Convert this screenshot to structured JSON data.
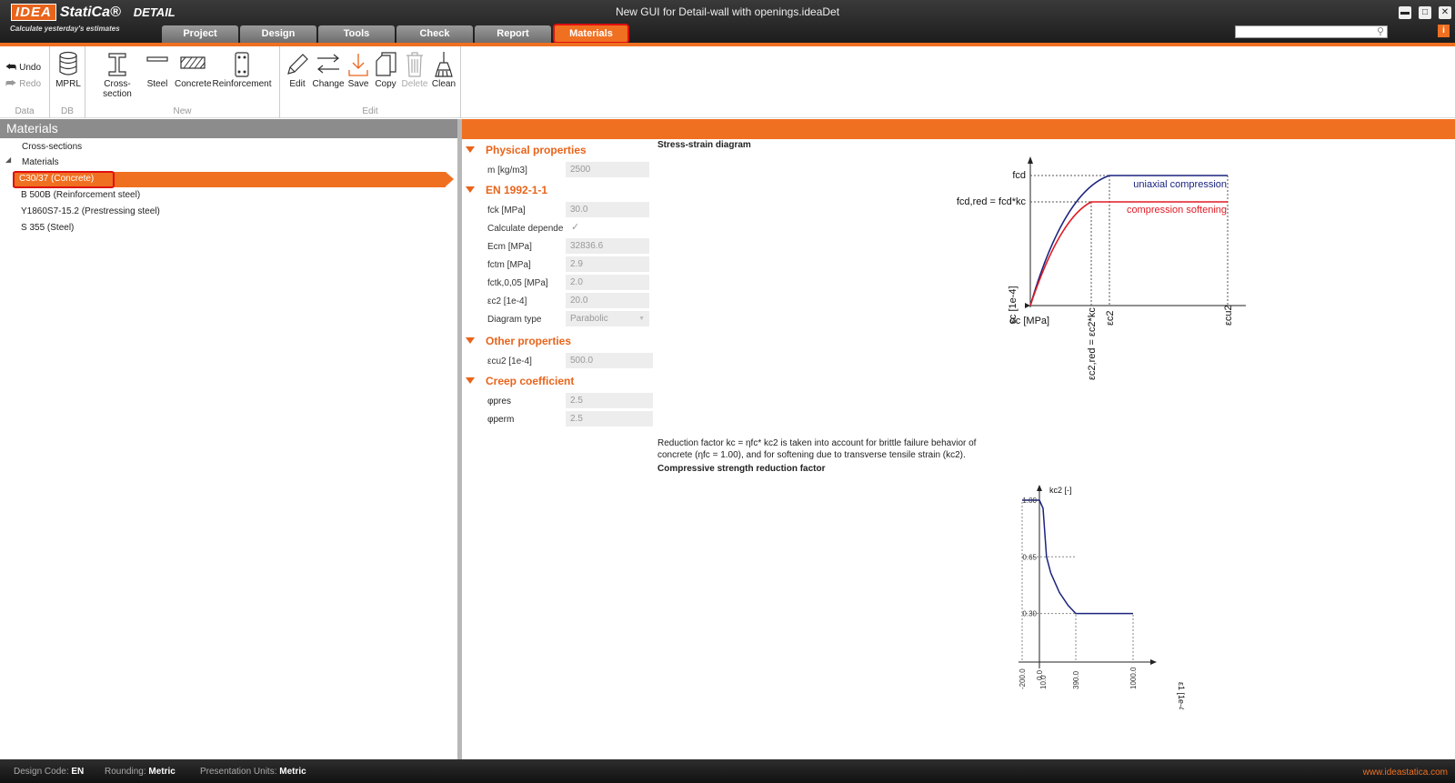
{
  "app": {
    "logo_brand": "IDEA",
    "logo_name": "StatiCa®",
    "product": "DETAIL",
    "tagline": "Calculate yesterday's estimates",
    "document_title": "New GUI for Detail-wall with openings.ideaDet"
  },
  "tabs": [
    {
      "label": "Project"
    },
    {
      "label": "Design"
    },
    {
      "label": "Tools"
    },
    {
      "label": "Check"
    },
    {
      "label": "Report"
    },
    {
      "label": "Materials",
      "active": true
    }
  ],
  "ribbon": {
    "data": {
      "undo": "Undo",
      "redo": "Redo",
      "label": "Data"
    },
    "db": {
      "mprl": "MPRL",
      "label": "DB"
    },
    "new": {
      "cross_section": "Cross-section",
      "steel": "Steel",
      "concrete": "Concrete",
      "reinforcement": "Reinforcement",
      "label": "New"
    },
    "edit": {
      "edit": "Edit",
      "change": "Change",
      "save": "Save",
      "copy": "Copy",
      "delete": "Delete",
      "clean": "Clean",
      "label": "Edit"
    }
  },
  "tree": {
    "header": "Materials",
    "cross_sections": "Cross-sections",
    "materials": "Materials",
    "items": [
      {
        "label": "C30/37 (Concrete)",
        "selected": true
      },
      {
        "label": "B 500B (Reinforcement steel)"
      },
      {
        "label": "Y1860S7-15.2 (Prestressing steel)"
      },
      {
        "label": "S 355 (Steel)"
      }
    ]
  },
  "properties": {
    "physical": {
      "title": "Physical properties",
      "m_label": "m [kg/m3]",
      "m_value": "2500"
    },
    "en": {
      "title": "EN 1992-1-1",
      "fck_label": "fck [MPa]",
      "fck_value": "30.0",
      "calc_label": "Calculate depende",
      "ecm_label": "Ecm [MPa]",
      "ecm_value": "32836.6",
      "fctm_label": "fctm [MPa]",
      "fctm_value": "2.9",
      "fctk_label": "fctk,0,05 [MPa]",
      "fctk_value": "2.0",
      "ec2_label": "εc2 [1e-4]",
      "ec2_value": "20.0",
      "dtype_label": "Diagram type",
      "dtype_value": "Parabolic"
    },
    "other": {
      "title": "Other properties",
      "ecu2_label": "εcu2 [1e-4]",
      "ecu2_value": "500.0"
    },
    "creep": {
      "title": "Creep coefficient",
      "pres_label": "φpres",
      "pres_value": "2.5",
      "perm_label": "φperm",
      "perm_value": "2.5"
    }
  },
  "stress_strain": {
    "title": "Stress-strain diagram",
    "fcd": "fcd",
    "fcd_red": "fcd,red = fcd*kc",
    "uniaxial": "uniaxial compression",
    "softening": "compression softening",
    "y_axis": "εc [1e-4]",
    "x_axis": "σc [MPa]",
    "ec2_red": "εc2,red = εc2*kc",
    "ec2": "εc2",
    "ecu2": "εcu2",
    "colors": {
      "uniaxial": "#1a237e",
      "softening": "#e01b24"
    }
  },
  "note": {
    "text": "Reduction factor kc = ηfc* kc2 is taken into account for brittle failure behavior of concrete (ηfc = 1.00), and for softening due to transverse tensile strain (kc2).",
    "subtitle": "Compressive strength reduction factor"
  },
  "kc2_chart": {
    "y_label": "kc2 [-]",
    "x_label": "ε1 [1e-4]",
    "y_ticks": [
      "1.00",
      "0.65",
      "0.30"
    ],
    "x_ticks": [
      "-200.0",
      "10.0",
      "390.0",
      "1000.0"
    ],
    "x_tick2": "0.0"
  },
  "chart_data": {
    "type": "line",
    "title": "Compressive strength reduction factor",
    "xlabel": "ε1 [1e-4]",
    "ylabel": "kc2 [-]",
    "series": [
      {
        "name": "",
        "x": [
          -200,
          0,
          10,
          50,
          100,
          200,
          300,
          390,
          1000
        ],
        "y": [
          1.0,
          1.0,
          0.95,
          0.65,
          0.55,
          0.43,
          0.35,
          0.3,
          0.3
        ]
      }
    ],
    "xlim": [
      -200,
      1000
    ],
    "ylim": [
      0,
      1.0
    ]
  },
  "status": {
    "design_code_label": "Design Code:",
    "design_code": "EN",
    "rounding_label": "Rounding:",
    "rounding": "Metric",
    "units_label": "Presentation Units:",
    "units": "Metric",
    "website": "www.ideastatica.com"
  }
}
